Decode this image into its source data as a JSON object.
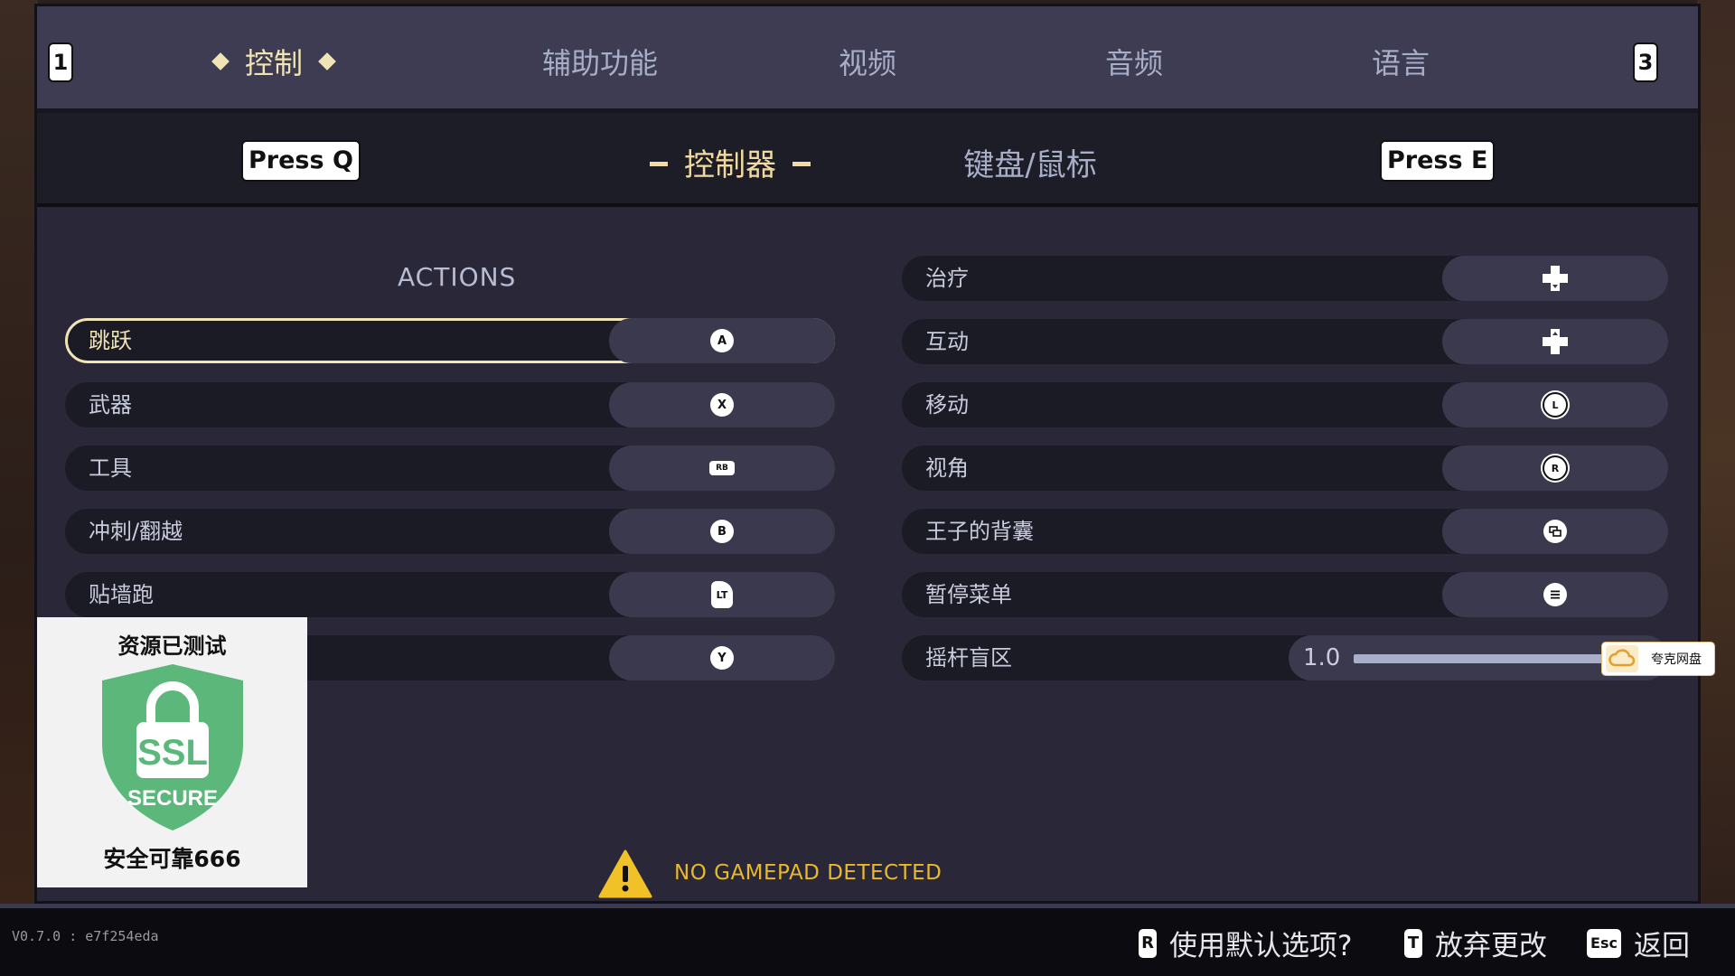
{
  "top_tabs": {
    "left_key": "1",
    "right_key": "3",
    "items": [
      "控制",
      "辅助功能",
      "视频",
      "音频",
      "语言"
    ],
    "active_index": 0
  },
  "sub_tabs": {
    "left_prompt": "Press Q",
    "right_prompt": "Press E",
    "items": [
      "控制器",
      "键盘/鼠标"
    ],
    "active_index": 0
  },
  "actions_header": "ACTIONS",
  "left_bindings": [
    {
      "label": "跳跃",
      "glyph": "A",
      "glyph_type": "circle",
      "selected": true
    },
    {
      "label": "武器",
      "glyph": "X",
      "glyph_type": "circle"
    },
    {
      "label": "工具",
      "glyph": "RB",
      "glyph_type": "bumper"
    },
    {
      "label": "冲刺/翻越",
      "glyph": "B",
      "glyph_type": "circle"
    },
    {
      "label": "贴墙跑",
      "glyph": "LT",
      "glyph_type": "trigger"
    },
    {
      "label": "",
      "glyph": "Y",
      "glyph_type": "circle"
    }
  ],
  "right_bindings": [
    {
      "label": "治疗",
      "glyph_icon": "dpad-down-icon"
    },
    {
      "label": "互动",
      "glyph_icon": "dpad-up-icon"
    },
    {
      "label": "移动",
      "glyph": "L",
      "glyph_type": "stick"
    },
    {
      "label": "视角",
      "glyph": "R",
      "glyph_type": "stick"
    },
    {
      "label": "王子的背囊",
      "glyph_icon": "view-button-icon"
    },
    {
      "label": "暂停菜单",
      "glyph_icon": "menu-button-icon"
    }
  ],
  "deadzone": {
    "label": "摇杆盲区",
    "value": "1.0",
    "fill_fraction": 1.0
  },
  "warning": {
    "text": "NO GAMEPAD DETECTED",
    "color": "#e9b82b"
  },
  "version": "V0.7.0 : e7f254eda",
  "footer_hints": [
    {
      "key": "R",
      "label": "使用默认选项?"
    },
    {
      "key": "T",
      "label": "放弃更改"
    },
    {
      "key": "Esc",
      "label": "返回"
    }
  ],
  "watermark": {
    "top_text": "资源已测试",
    "badge_text_1": "SSL",
    "badge_text_2": "SECURE",
    "bottom_text": "安全可靠666"
  },
  "overlay_badge": {
    "text": "夸克网盘"
  },
  "colors": {
    "accent": "#f1e4b4",
    "panel": "#2a2838",
    "row": "#1b1b25",
    "pill": "#3a394e",
    "warning": "#e9b82b",
    "shield": "#5cb87a"
  }
}
